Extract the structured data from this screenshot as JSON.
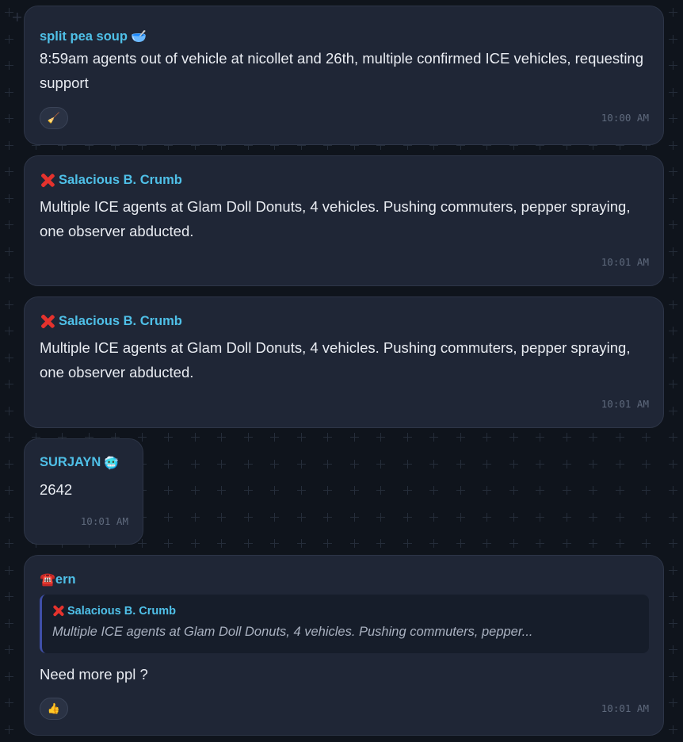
{
  "messages": [
    {
      "sender": "split pea soup",
      "sender_emoji": "🥣",
      "text": "8:59am agents out of vehicle at nicollet and 26th, multiple confirmed ICE vehicles, requesting support",
      "reaction": "🧹",
      "time": "10:00 AM"
    },
    {
      "sender_icon": "cross-mark",
      "sender": "Salacious B. Crumb",
      "text": "Multiple ICE agents at Glam Doll Donuts, 4 vehicles. Pushing commuters, pepper spraying, one observer abducted.",
      "time": "10:01 AM"
    },
    {
      "sender_icon": "cross-mark",
      "sender": "Salacious B. Crumb",
      "text": "Multiple ICE agents at Glam Doll Donuts, 4 vehicles. Pushing commuters, pepper spraying, one observer abducted.",
      "time": "10:01 AM"
    },
    {
      "sender": "SURJAYN",
      "sender_emoji": "🥶",
      "text": "2642",
      "time": "10:01 AM"
    },
    {
      "sender_emoji": "☎️",
      "sender": "ern",
      "reply": {
        "sender_icon": "cross-mark",
        "sender": "Salacious B. Crumb",
        "text": "Multiple ICE agents at Glam Doll Donuts, 4 vehicles. Pushing commuters, pepper..."
      },
      "text": "Need more ppl ?",
      "reaction": "👍",
      "time": "10:01 AM"
    }
  ],
  "colors": {
    "background": "#0f141c",
    "bubble": "#1f2636",
    "sender": "#4fc0e8",
    "timestamp": "#5f6a7d",
    "cross": "#e5322d",
    "reply_bar": "#3f4fa8"
  }
}
